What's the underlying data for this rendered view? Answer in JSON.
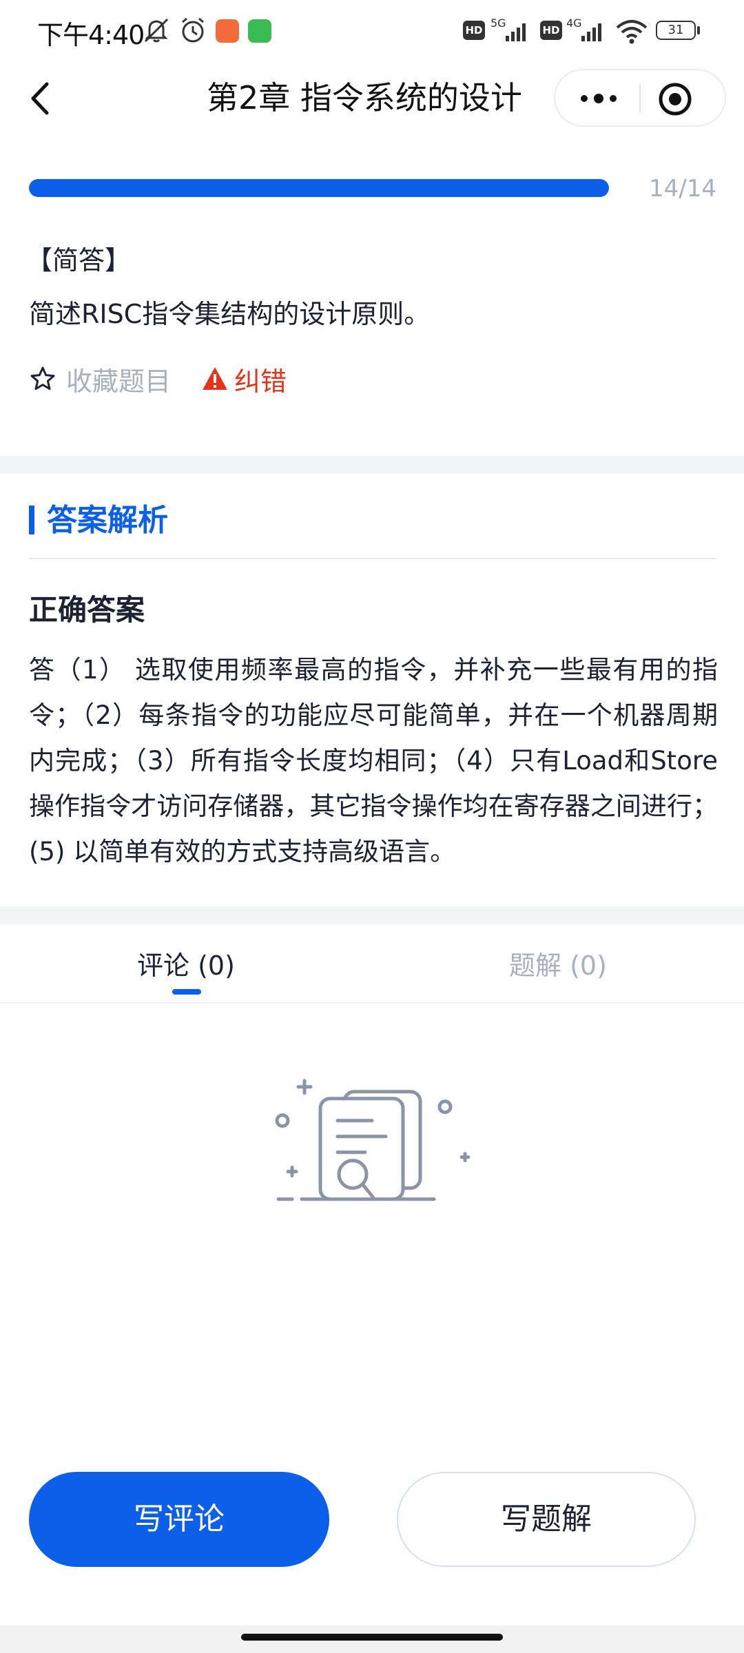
{
  "status_bar": {
    "time": "下午4:40",
    "network_5g": "5G",
    "network_4g": "4G",
    "hd1": "HD",
    "hd2": "HD",
    "battery": "31",
    "icons": [
      "mute-icon",
      "alarm-icon",
      "app-badge-orange-icon",
      "app-badge-green-icon",
      "signal-icon",
      "wifi-icon",
      "battery-icon"
    ]
  },
  "nav": {
    "title": "第2章  指令系统的设计"
  },
  "progress": {
    "text": "14/14",
    "current": 14,
    "total": 14,
    "fraction": 1.0
  },
  "question": {
    "type_label": "【简答】",
    "text": "简述RISC指令集结构的设计原则。",
    "favorite_label": "收藏题目",
    "report_label": "纠错"
  },
  "answer": {
    "heading": "答案解析",
    "correct_label": "正确答案",
    "text": "答（1） 选取使用频率最高的指令，并补充一些最有用的指令；（2）每条指令的功能应尽可能简单，并在一个机器周期内完成；（3）所有指令长度均相同；（4）只有Load和Store操作指令才访问存储器，其它指令操作均在寄存器之间进行；(5) 以简单有效的方式支持高级语言。"
  },
  "tabs": [
    {
      "label": "评论 (0)",
      "active": true
    },
    {
      "label": "题解 (0)",
      "active": false
    }
  ],
  "buttons": {
    "write_comment": "写评论",
    "write_solution": "写题解"
  },
  "colors": {
    "accent": "#0b5fe8",
    "muted": "#a7b0bf",
    "error": "#e5341c",
    "text": "#1c2233"
  }
}
